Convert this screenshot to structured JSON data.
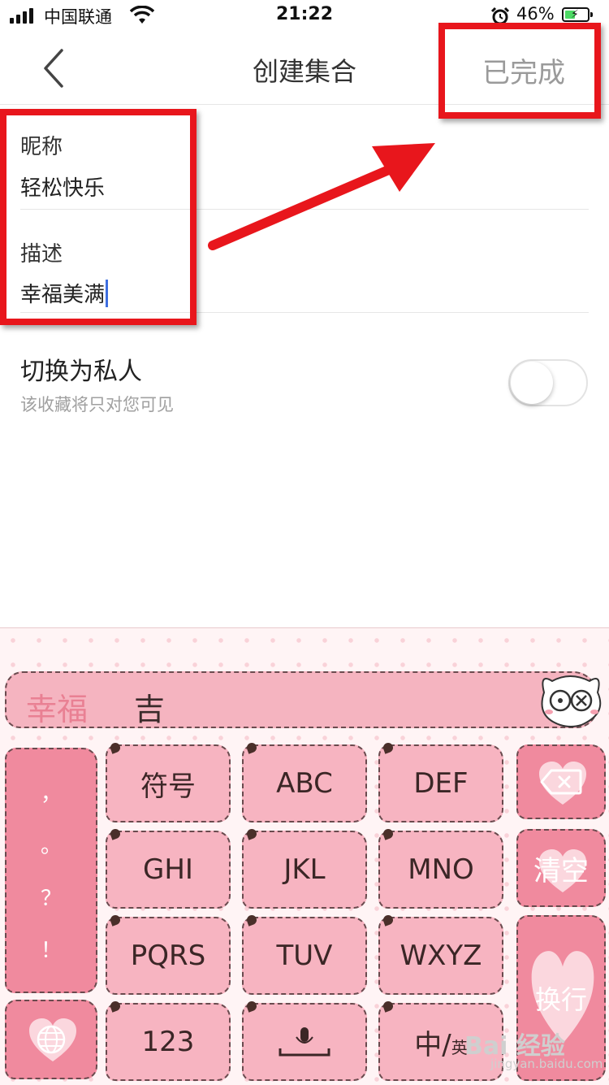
{
  "status_bar": {
    "carrier": "中国联通",
    "time": "21:22",
    "battery_percent": "46%",
    "battery_level": 0.46,
    "icons": [
      "signal-icon",
      "wifi-icon",
      "alarm-icon",
      "battery-icon",
      "charging-icon"
    ]
  },
  "nav": {
    "back_icon": "chevron-left-icon",
    "title": "创建集合",
    "done_label": "已完成"
  },
  "form": {
    "nickname_label": "昵称",
    "nickname_value": "轻松快乐",
    "description_label": "描述",
    "description_value": "幸福美满",
    "private_title": "切换为私人",
    "private_subtitle": "该收藏将只对您可见",
    "private_enabled": false
  },
  "keyboard": {
    "candidate_primary": "幸福",
    "candidate_secondary": "吉",
    "punctuation": [
      "，",
      "。",
      "？",
      "！"
    ],
    "keys": [
      "符号",
      "ABC",
      "DEF",
      "GHI",
      "JKL",
      "MNO",
      "PQRS",
      "TUV",
      "WXYZ",
      "123"
    ],
    "lang_main": "中/",
    "lang_small": "英",
    "clear_label": "清空",
    "enter_label": "换行",
    "accent_color": "#f7b4c1"
  },
  "annotations": {
    "color": "#e8161c"
  },
  "watermark": {
    "brand": "Bai 经验",
    "url": "jingyan.baidu.com"
  }
}
